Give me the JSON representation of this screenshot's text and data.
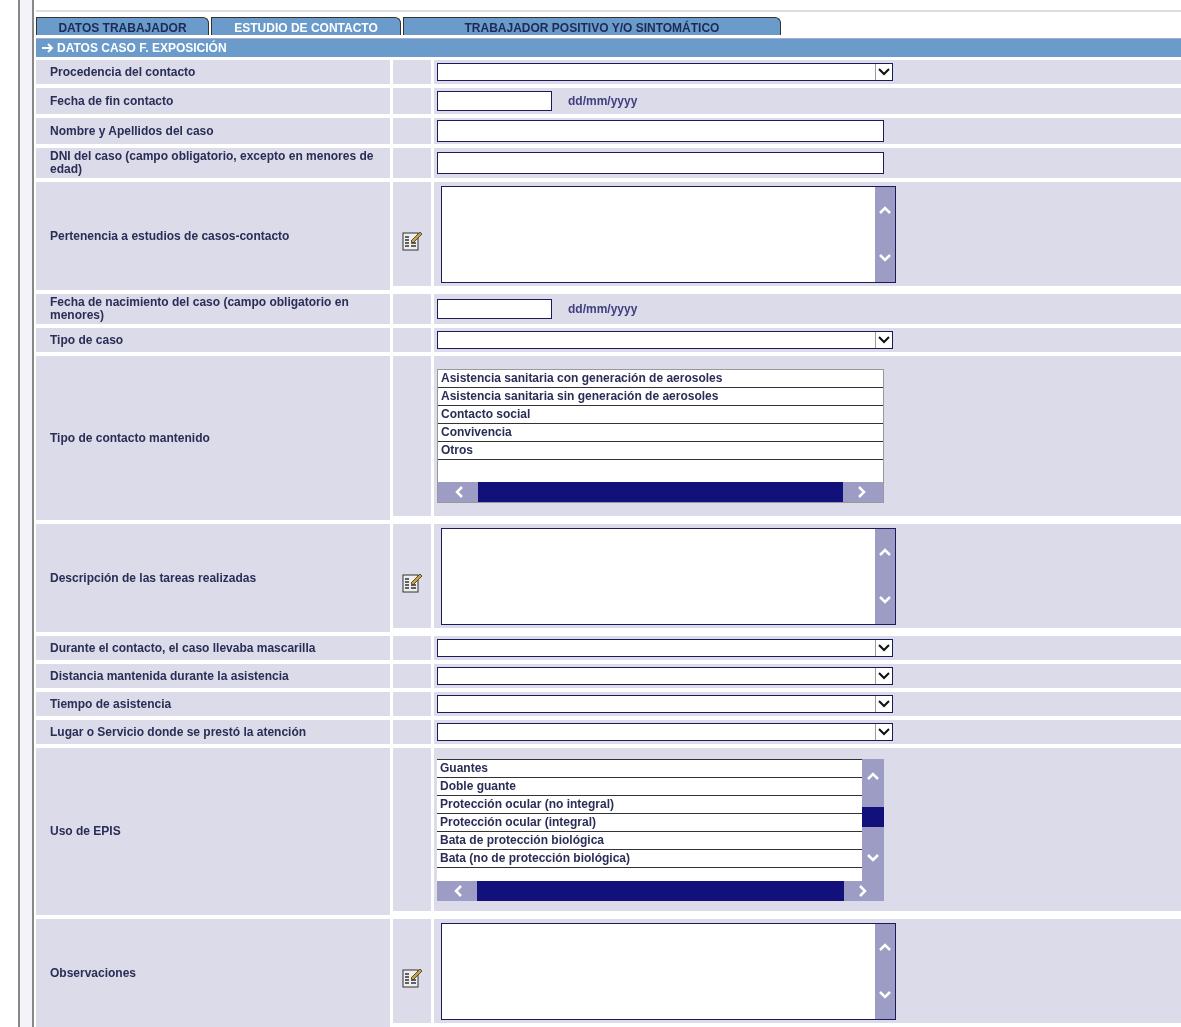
{
  "tabs": [
    {
      "label": "DATOS TRABAJADOR",
      "selected": false
    },
    {
      "label": "ESTUDIO DE CONTACTO",
      "selected": true
    },
    {
      "label": "TRABAJADOR POSITIVO Y/O SINTOMÁTICO",
      "selected": false
    }
  ],
  "section": {
    "title": "DATOS CASO F. EXPOSICIÓN"
  },
  "rows": [
    {
      "label": "Procedencia del contacto",
      "kind": "select"
    },
    {
      "label": "Fecha de fin contacto",
      "kind": "date",
      "hint": "dd/mm/yyyy"
    },
    {
      "label": "Nombre y Apellidos del caso",
      "kind": "text"
    },
    {
      "label": "DNI del caso (campo obligatorio, excepto en menores de edad)",
      "kind": "text"
    },
    {
      "label": "Pertenencia a estudios de casos-contacto",
      "kind": "textarea"
    },
    {
      "label": "Fecha de nacimiento del caso (campo obligatorio en menores)",
      "kind": "date",
      "hint": "dd/mm/yyyy"
    },
    {
      "label": "Tipo de caso",
      "kind": "select"
    },
    {
      "label": "Tipo de contacto mantenido",
      "kind": "listbox",
      "options": [
        "Asistencia sanitaria con generación de aerosoles",
        "Asistencia sanitaria sin generación de aerosoles",
        "Contacto social",
        "Convivencia",
        "Otros"
      ]
    },
    {
      "label": "Descripción de las tareas realizadas",
      "kind": "textarea"
    },
    {
      "label": "Durante el contacto, el caso llevaba mascarilla",
      "kind": "select"
    },
    {
      "label": "Distancia mantenida durante la asistencia",
      "kind": "select"
    },
    {
      "label": "Tiempo de asistencia",
      "kind": "select"
    },
    {
      "label": "Lugar o Servicio donde se prestó la atención",
      "kind": "select"
    },
    {
      "label": "Uso de EPIS",
      "kind": "listbox-scroll",
      "options": [
        "Guantes",
        "Doble guante",
        "Protección ocular (no integral)",
        "Protección ocular (integral)",
        "Bata de protección biológica",
        "Bata (no de protección biológica)"
      ]
    },
    {
      "label": "Observaciones",
      "kind": "textarea"
    }
  ]
}
